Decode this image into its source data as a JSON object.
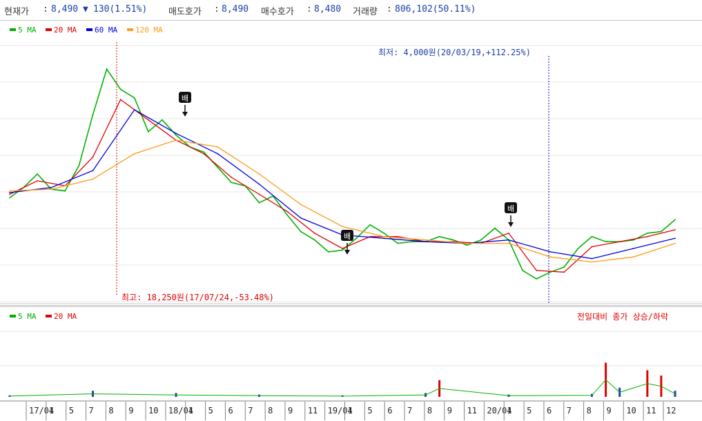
{
  "info_bar": {
    "current_label": "현재가",
    "current_value": "8,490",
    "change_value": "130(1.51%)",
    "ask_label": "매도호가",
    "ask_value": "8,490",
    "bid_label": "매수호가",
    "bid_value": "8,480",
    "volume_label": "거래량",
    "volume_value": "806,102(50.11%)",
    "colors": {
      "label": "#333333",
      "value": "#1a3fa8",
      "down": "#1a3fa8"
    }
  },
  "price_legend": [
    {
      "name": "5 MA",
      "color": "#00b000"
    },
    {
      "name": "20 MA",
      "color": "#e00000"
    },
    {
      "name": "60 MA",
      "color": "#0000e0"
    },
    {
      "name": "120 MA",
      "color": "#ff9a1a"
    }
  ],
  "volume_legend": [
    {
      "name": "5 MA",
      "color": "#00b000"
    },
    {
      "name": "20 MA",
      "color": "#e00000"
    }
  ],
  "volume_note": "전일대비 종가 상승/하락",
  "annotations": {
    "high": "최고: 18,250원(17/07/24,-53.48%)",
    "low": "최저: 4,000원(20/03/19,+112.25%)",
    "marker_label": "배"
  },
  "chart_data": {
    "type": "line",
    "series": [
      {
        "name": "5 MA",
        "color": "#00b000",
        "x": [
          0,
          1,
          2,
          3,
          4,
          5,
          6,
          7,
          8,
          9,
          10,
          11,
          12,
          13,
          14,
          15,
          16,
          17,
          18,
          19,
          20,
          21,
          22,
          23,
          24,
          25,
          26,
          27,
          28,
          29,
          30,
          31,
          32,
          33,
          34,
          35,
          36,
          37,
          38,
          39,
          40,
          41,
          42,
          43,
          44,
          45,
          46,
          47,
          48
        ],
        "values": [
          9.6,
          10.2,
          11.0,
          10.1,
          10.0,
          11.5,
          14.5,
          17.2,
          16.0,
          15.5,
          13.5,
          14.2,
          13.3,
          12.6,
          12.3,
          11.4,
          10.5,
          10.3,
          9.3,
          9.7,
          8.6,
          7.6,
          7.1,
          6.4,
          6.5,
          7.2,
          8.0,
          7.5,
          6.9,
          7.0,
          7.0,
          7.3,
          7.1,
          6.8,
          7.1,
          7.8,
          7.1,
          5.3,
          4.8,
          5.2,
          5.5,
          6.6,
          7.3,
          7.0,
          7.0,
          7.1,
          7.5,
          7.6,
          8.3
        ]
      },
      {
        "name": "20 MA",
        "color": "#e00000",
        "x": [
          0,
          2,
          4,
          6,
          8,
          10,
          12,
          14,
          16,
          18,
          20,
          22,
          24,
          26,
          28,
          30,
          32,
          34,
          36,
          38,
          40,
          42,
          44,
          46,
          48
        ],
        "values": [
          9.8,
          10.6,
          10.3,
          12.0,
          15.4,
          14.2,
          13.0,
          12.2,
          10.8,
          9.8,
          8.8,
          7.5,
          6.6,
          7.3,
          7.3,
          7.0,
          7.0,
          6.9,
          7.5,
          5.3,
          5.2,
          6.7,
          7.0,
          7.3,
          7.7
        ]
      },
      {
        "name": "60 MA",
        "color": "#0000e0",
        "x": [
          0,
          3,
          6,
          9,
          12,
          15,
          18,
          21,
          24,
          27,
          30,
          33,
          36,
          39,
          42,
          45,
          48
        ],
        "values": [
          9.9,
          10.2,
          11.2,
          14.8,
          13.4,
          12.2,
          10.4,
          8.4,
          7.4,
          7.2,
          7.0,
          6.9,
          7.1,
          6.4,
          6.0,
          6.6,
          7.2
        ]
      },
      {
        "name": "120 MA",
        "color": "#ff9a1a",
        "x": [
          0,
          3,
          6,
          9,
          12,
          15,
          18,
          21,
          24,
          27,
          30,
          33,
          36,
          39,
          42,
          45,
          48
        ],
        "values": [
          10.0,
          10.1,
          10.7,
          12.2,
          13.0,
          12.6,
          11.0,
          9.2,
          7.9,
          7.3,
          7.1,
          6.9,
          6.9,
          6.1,
          5.8,
          6.1,
          6.9
        ]
      }
    ],
    "x_tick_labels": [
      "17/01",
      "4",
      "5",
      "7",
      "8",
      "9",
      "10",
      "18/01",
      "4",
      "5",
      "6",
      "7",
      "8",
      "9",
      "11",
      "19/01",
      "4",
      "5",
      "6",
      "7",
      "8",
      "9",
      "11",
      "20/01",
      "4",
      "5",
      "6",
      "7",
      "8",
      "9",
      "10",
      "11",
      "12"
    ],
    "ylim": [
      3.5,
      19.0
    ],
    "volume": {
      "x": [
        0,
        6,
        12,
        18,
        24,
        30,
        31,
        36,
        42,
        43,
        44,
        46,
        47,
        48
      ],
      "values": [
        0.02,
        0.08,
        0.05,
        0.03,
        0.02,
        0.05,
        0.22,
        0.03,
        0.04,
        0.45,
        0.12,
        0.35,
        0.28,
        0.08
      ],
      "ylim": [
        0,
        1
      ]
    },
    "grid": true
  }
}
